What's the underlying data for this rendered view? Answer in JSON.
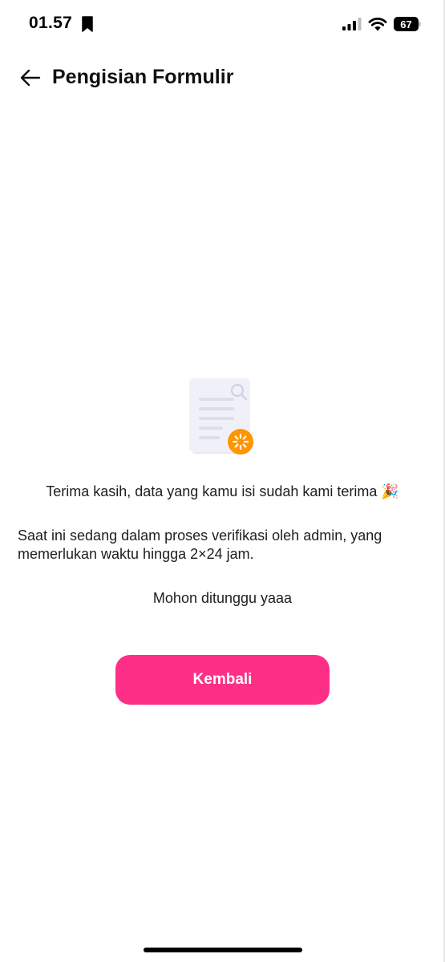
{
  "status_bar": {
    "time": "01.57",
    "battery_level": "67",
    "icons": [
      "bookmark-icon",
      "signal-icon",
      "wifi-icon",
      "battery-icon"
    ]
  },
  "header": {
    "title": "Pengisian Formulir",
    "back_icon": "arrow-left-icon"
  },
  "illustration": {
    "icon": "document-pending-icon",
    "accent_color": "#FF9500"
  },
  "content": {
    "thanks": "Terima kasih, data yang kamu isi sudah kami terima 🎉",
    "verification": "Saat ini sedang dalam proses verifikasi oleh admin, yang memerlukan waktu hingga 2×24 jam.",
    "wait": "Mohon ditunggu yaaa"
  },
  "actions": {
    "back_label": "Kembali"
  },
  "colors": {
    "primary": "#FE2F86",
    "text": "#1E1E1E"
  }
}
